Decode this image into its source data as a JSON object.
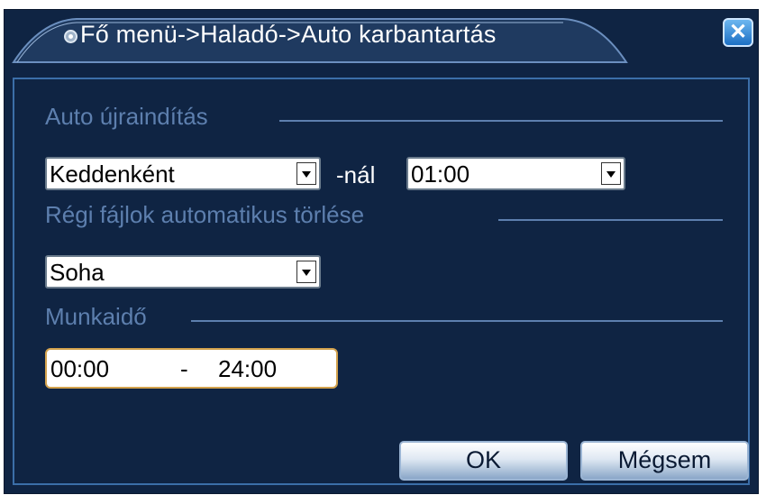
{
  "window": {
    "title": "Fő menü->Haladó->Auto karbantartás",
    "close_label": "✕"
  },
  "auto_restart": {
    "label": "Auto újraindítás",
    "day_value": "Keddenként",
    "at_label": "-nál",
    "time_value": "01:00"
  },
  "old_files": {
    "label": "Régi fájlok automatikus törlése",
    "value": "Soha"
  },
  "work_time": {
    "label": "Munkaidő",
    "start": "00:00",
    "separator": "-",
    "end": "24:00"
  },
  "buttons": {
    "ok_label": "OK",
    "cancel_label": "Mégsem"
  },
  "colors": {
    "panel_bg": "#0f2443",
    "section_text": "#5d7fae",
    "frame_border": "#3b6ea8"
  }
}
